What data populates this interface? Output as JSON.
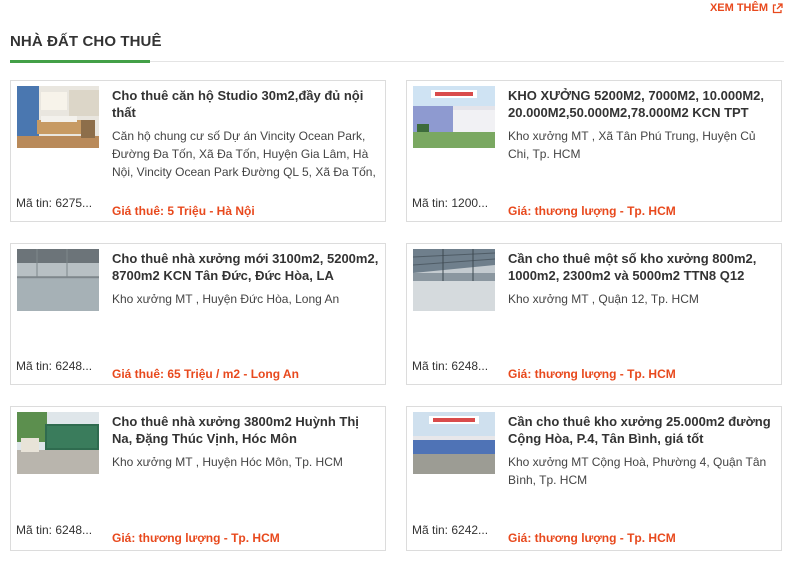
{
  "header": {
    "more_label": "XEM THÊM",
    "more_icon": "external-link-icon",
    "section_title": "NHÀ ĐẤT CHO THUÊ",
    "accent_color": "#43a047",
    "link_color": "#e8491d"
  },
  "listings": [
    {
      "title": "Cho thuê căn hộ Studio 30m2,đầy đủ nội thất",
      "description": "Căn hộ chung cư số Dự án Vincity Ocean Park, Đường Đa Tốn, Xã Đa Tốn, Huyện Gia Lâm, Hà Nội, Vincity Ocean Park Đường QL 5, Xã Đa Tốn,",
      "code": "Mã tin: 6275...",
      "price": "Giá thuê: 5 Triệu - Hà Nội"
    },
    {
      "title": "KHO XƯỞNG 5200M2, 7000M2, 10.000M2, 20.000M2,50.000M2,78.000M2 KCN TPT",
      "description": "Kho xưởng MT , Xã Tân Phú Trung, Huyện Củ Chi, Tp. HCM",
      "code": "Mã tin: 1200...",
      "price": "Giá: thương lượng - Tp. HCM"
    },
    {
      "title": "Cho thuê nhà xưởng mới 3100m2, 5200m2, 8700m2 KCN Tân Đức, Đức Hòa, LA",
      "description": "Kho xưởng MT , Huyện Đức Hòa, Long An",
      "code": "Mã tin: 6248...",
      "price": "Giá thuê: 65 Triệu / m2 - Long An"
    },
    {
      "title": "Cần cho thuê một số kho xưởng 800m2, 1000m2, 2300m2 và 5000m2 TTN8 Q12",
      "description": "Kho xưởng MT , Quận 12, Tp. HCM",
      "code": "Mã tin: 6248...",
      "price": "Giá: thương lượng - Tp. HCM"
    },
    {
      "title": "Cho thuê nhà xưởng 3800m2 Huỳnh Thị Na, Đặng Thúc Vịnh, Hóc Môn",
      "description": "Kho xưởng MT , Huyện Hóc Môn, Tp. HCM",
      "code": "Mã tin: 6248...",
      "price": "Giá: thương lượng - Tp. HCM"
    },
    {
      "title": "Cần cho thuê kho xưởng 25.000m2 đường Cộng Hòa, P.4, Tân Bình, giá tốt",
      "description": "Kho xưởng MT Cộng Hoà, Phường 4, Quận Tân Bình, Tp. HCM",
      "code": "Mã tin: 6242...",
      "price": "Giá: thương lượng - Tp. HCM"
    }
  ]
}
